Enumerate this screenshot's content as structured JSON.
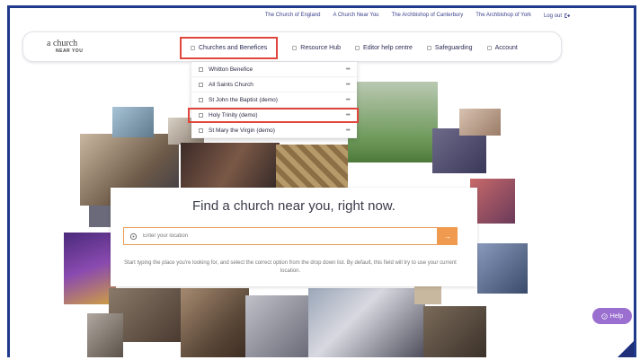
{
  "top_links": [
    "The Church of England",
    "A Church Near You",
    "The Archbishop of Canterbury",
    "The Archbishop of York"
  ],
  "logout_label": "Log out",
  "logo": {
    "main": "a church",
    "sub": "NEAR YOU"
  },
  "nav": [
    {
      "label": "Churches and Benefices",
      "active": true
    },
    {
      "label": "Resource Hub"
    },
    {
      "label": "Editor help centre"
    },
    {
      "label": "Safeguarding"
    },
    {
      "label": "Account"
    }
  ],
  "dropdown": [
    {
      "label": "Whitton Benefice"
    },
    {
      "label": "All Saints Church"
    },
    {
      "label": "St John the Baptist (demo)"
    },
    {
      "label": "Holy Trinity (demo)",
      "highlight": true
    },
    {
      "label": "St Mary the Virgin (demo)"
    }
  ],
  "panel": {
    "title": "Find a church near you, right now.",
    "placeholder": "Enter your location",
    "hint": "Start typing the place you're looking for, and select the correct option from the drop down list. By default, this field will try to use your current location."
  },
  "help_label": "Help",
  "colors": {
    "frame": "#1f3a8a",
    "highlight": "#e0463c",
    "accent": "#ef9a4e",
    "help": "#9b6fcf"
  }
}
